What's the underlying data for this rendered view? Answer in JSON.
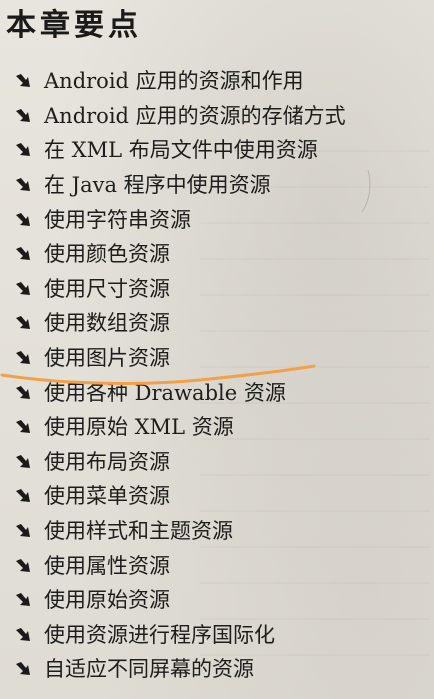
{
  "header": {
    "title": "本章要点"
  },
  "points": [
    "Android 应用的资源和作用",
    "Android 应用的资源的存储方式",
    "在 XML 布局文件中使用资源",
    "在 Java 程序中使用资源",
    "使用字符串资源",
    "使用颜色资源",
    "使用尺寸资源",
    "使用数组资源",
    "使用图片资源",
    "使用各种 Drawable 资源",
    "使用原始 XML 资源",
    "使用布局资源",
    "使用菜单资源",
    "使用样式和主题资源",
    "使用属性资源",
    "使用原始资源",
    "使用资源进行程序国际化",
    "自适应不同屏幕的资源"
  ],
  "colors": {
    "text": "#1d1d1d",
    "bullet": "#1a1a1a",
    "highlight": "#f2a14a",
    "paper": "#e4e1da"
  },
  "icons": {
    "bullet": "arrow-down-right-icon"
  }
}
